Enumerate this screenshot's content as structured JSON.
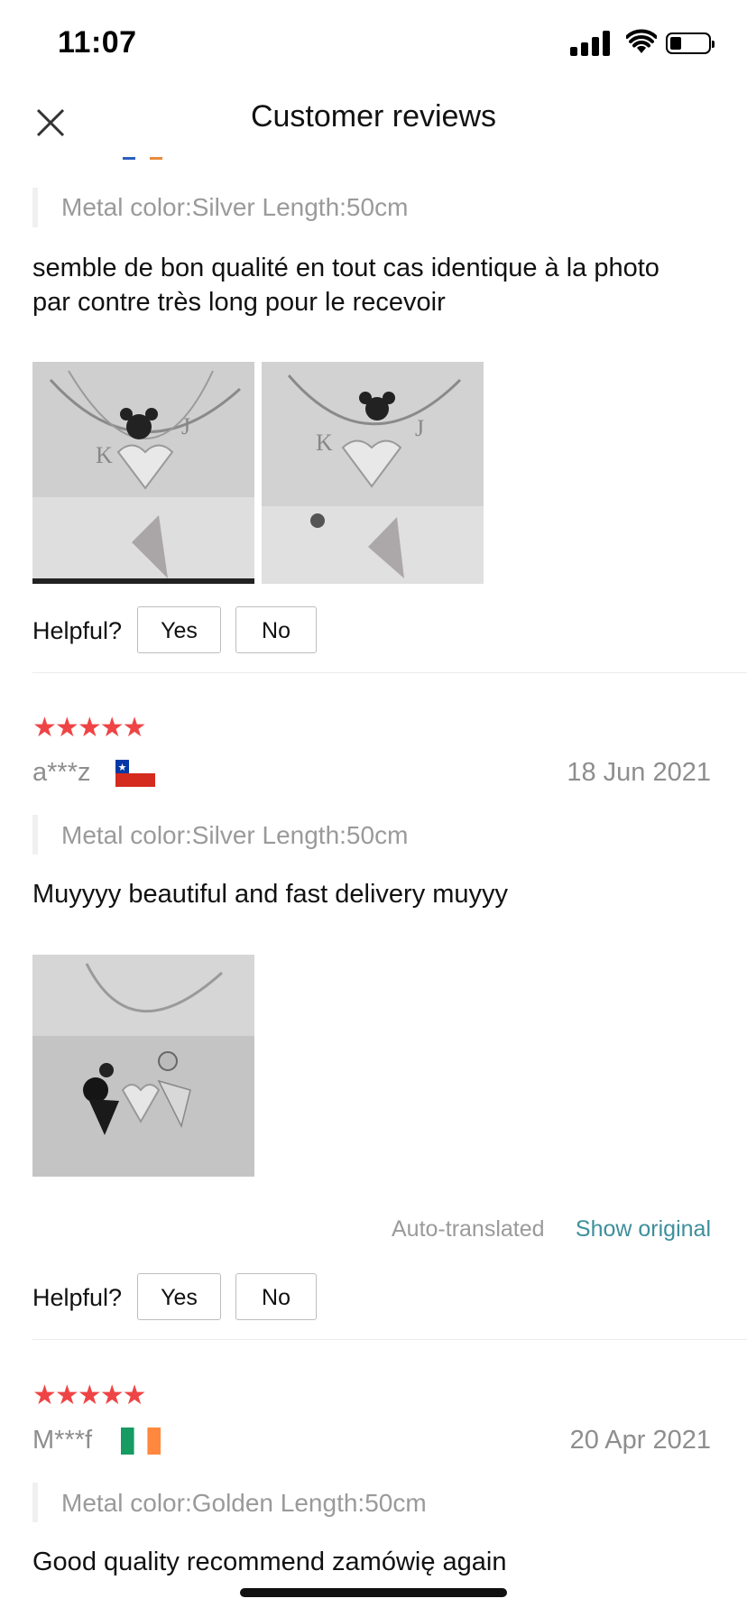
{
  "status_bar": {
    "time": "11:07"
  },
  "header": {
    "title": "Customer reviews"
  },
  "helpful_label": "Helpful?",
  "yes_label": "Yes",
  "no_label": "No",
  "reviews": [
    {
      "attributes": "Metal color:Silver Length:50cm",
      "text_line1": "semble de bon qualité en tout cas identique à la photo",
      "text_line2": "par contre très long pour le recevoir",
      "photo_count": 2
    },
    {
      "rating": 5,
      "reviewer": "a***z",
      "flag": "chile-flag",
      "date": "18 Jun 2021",
      "attributes": "Metal color:Silver Length:50cm",
      "text": "Muyyyy beautiful and fast delivery muyyy",
      "photo_count": 1,
      "auto_translated": "Auto-translated",
      "show_original": "Show original"
    },
    {
      "rating": 5,
      "reviewer": "M***f",
      "flag": "ireland-flag",
      "date": "20 Apr 2021",
      "attributes": "Metal color:Golden Length:50cm",
      "text": "Good quality recommend zamówię again"
    }
  ],
  "colors": {
    "star": "#ef4445",
    "link": "#3e8f9b",
    "muted": "#8e8e8e"
  }
}
